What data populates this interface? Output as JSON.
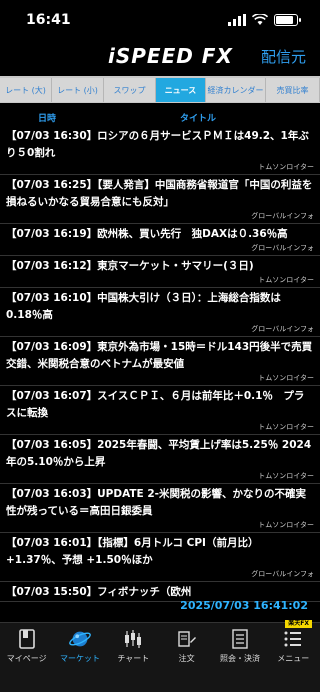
{
  "status_bar": {
    "time": "16:41",
    "battery_level": 0.85
  },
  "header": {
    "logo_text": "iSPEED FX",
    "right_link": "配信元"
  },
  "tabs": [
    {
      "label": "レート (大)",
      "active": false
    },
    {
      "label": "レート (小)",
      "active": false
    },
    {
      "label": "スワップ",
      "active": false
    },
    {
      "label": "ニュース",
      "active": true
    },
    {
      "label": "経済カレンダー",
      "active": false
    },
    {
      "label": "売買比率",
      "active": false
    }
  ],
  "columns": {
    "datetime": "日時",
    "title": "タイトル"
  },
  "news": [
    {
      "title": "【07/03 16:30】ロシアの６月サービスＰＭＩは49.2、1年ぶり５0割れ",
      "source": "トムソンロイター"
    },
    {
      "title": "【07/03 16:25】【要人発言】中国商務省報道官「中国の利益を損ねるいかなる貿易合意にも反対」",
      "source": "グローバルインフォ"
    },
    {
      "title": "【07/03 16:19】欧州株、買い先行　独DAXは０.36％高",
      "source": "グローバルインフォ"
    },
    {
      "title": "【07/03 16:12】東京マーケット・サマリー(３日)",
      "source": "トムソンロイター"
    },
    {
      "title": "【07/03 16:10】中国株大引け（３日）：上海総合指数は0.18％高",
      "source": "グローバルインフォ"
    },
    {
      "title": "【07/03 16:09】東京外為市場・15時＝ドル143円後半で売買交錯、米関税合意のベトナムが最安値",
      "source": "トムソンロイター"
    },
    {
      "title": "【07/03 16:07】スイスＣＰＩ、６月は前年比＋0.1％　プラスに転換",
      "source": "トムソンロイター"
    },
    {
      "title": "【07/03 16:05】2025年春闘、平均賃上げ率は5.25％ 2024年の5.10％から上昇",
      "source": "トムソンロイター"
    },
    {
      "title": "【07/03 16:03】UPDATE 2-米関税の影響、かなりの不確実性が残っている＝高田日銀委員",
      "source": "トムソンロイター"
    },
    {
      "title": "【07/03 16:01】【指標】6月トルコ CPI（前月比）+1.37％、予想 +1.50％ほか",
      "source": "グローバルインフォ"
    },
    {
      "title": "【07/03 15:50】フィボナッチ（欧州",
      "source": ""
    }
  ],
  "overlay_timestamp": "2025/07/03 16:41:02",
  "bottom_nav": [
    {
      "label": "マイページ",
      "icon": "book-icon",
      "active": false
    },
    {
      "label": "マーケット",
      "icon": "globe-icon",
      "active": true
    },
    {
      "label": "チャート",
      "icon": "candlestick-chart-icon",
      "active": false
    },
    {
      "label": "注文",
      "icon": "order-icon",
      "active": false
    },
    {
      "label": "照会・決済",
      "icon": "document-list-icon",
      "active": false
    },
    {
      "label": "メニュー",
      "icon": "menu-icon",
      "active": false,
      "badge": "楽天FX"
    }
  ]
}
